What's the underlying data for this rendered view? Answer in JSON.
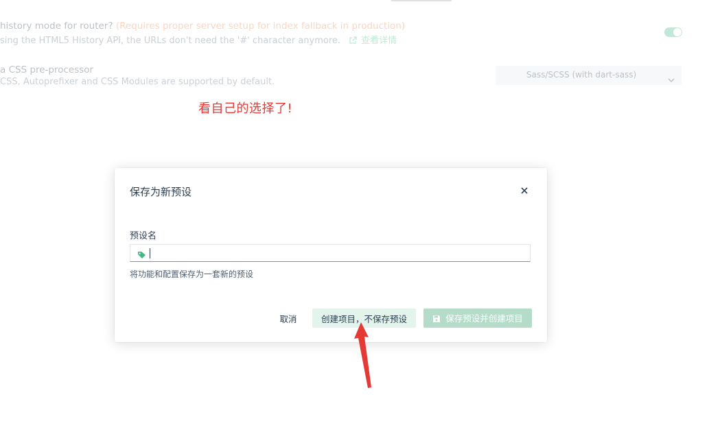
{
  "background": {
    "router_feature": {
      "title": "history mode for router?",
      "warning": "(Requires proper server setup for index fallback in production)",
      "description": "sing the HTML5 History API, the URLs don't need the '#' character anymore.",
      "more_link": "查看详情",
      "toggle_on": true
    },
    "css_feature": {
      "title": "a CSS pre-processor",
      "description": "CSS, Autoprefixer and CSS Modules are supported by default.",
      "select_value": "Sass/SCSS (with dart-sass)"
    }
  },
  "annotation": {
    "text": "看自己的选择了!",
    "color": "#e53935"
  },
  "modal": {
    "title": "保存为新预设",
    "close_icon": "close-icon",
    "field": {
      "label": "预设名",
      "value": "",
      "placeholder": "",
      "icon": "tag-icon",
      "help": "将功能和配置保存为一套新的预设"
    },
    "buttons": {
      "cancel": "取消",
      "create_without_save": "创建项目，不保存预设",
      "save_and_create": "保存预设并创建项目",
      "save_icon": "save-icon"
    }
  },
  "colors": {
    "accent": "#42b983",
    "text": "#2c3e50",
    "warning": "#f07c3e",
    "annotation": "#e53935"
  }
}
